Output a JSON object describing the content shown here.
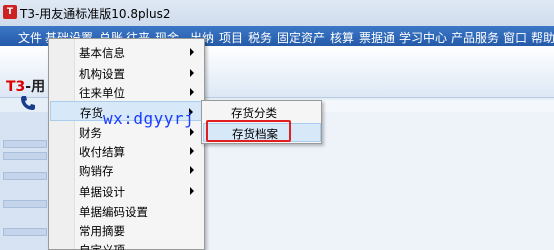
{
  "window": {
    "title": "T3-用友通标准版10.8plus2"
  },
  "menubar": {
    "items": [
      "文件",
      "基础设置",
      "总账",
      "往来",
      "现金",
      "出纳",
      "项目",
      "税务",
      "固定资产",
      "核算",
      "票据通",
      "学习中心",
      "产品服务",
      "窗口",
      "帮助"
    ]
  },
  "banner": {
    "logo_prefix": "T3",
    "logo_suffix": "-用"
  },
  "dropdown": {
    "items": [
      {
        "label": "基本信息",
        "has_submenu": true
      },
      {
        "label": "机构设置",
        "has_submenu": true
      },
      {
        "label": "往来单位",
        "has_submenu": true
      },
      {
        "label": "存货",
        "has_submenu": true,
        "highlighted": true
      },
      {
        "label": "财务",
        "has_submenu": true
      },
      {
        "label": "收付结算",
        "has_submenu": true
      },
      {
        "label": "购销存",
        "has_submenu": true
      },
      {
        "label": "单据设计",
        "has_submenu": true
      },
      {
        "label": "单据编码设置",
        "has_submenu": false
      },
      {
        "label": "常用摘要",
        "has_submenu": false
      },
      {
        "label": "自定义项",
        "has_submenu": false
      }
    ]
  },
  "submenu": {
    "items": [
      {
        "label": "存货分类"
      },
      {
        "label": "存货档案",
        "highlighted": true
      }
    ]
  },
  "watermark": {
    "text": "wx:dgyyrj"
  },
  "colors": {
    "menubar": "#2e66b8",
    "highlight": "#d7e8f8",
    "red_box": "#e02020",
    "watermark": "#1a3cff"
  }
}
